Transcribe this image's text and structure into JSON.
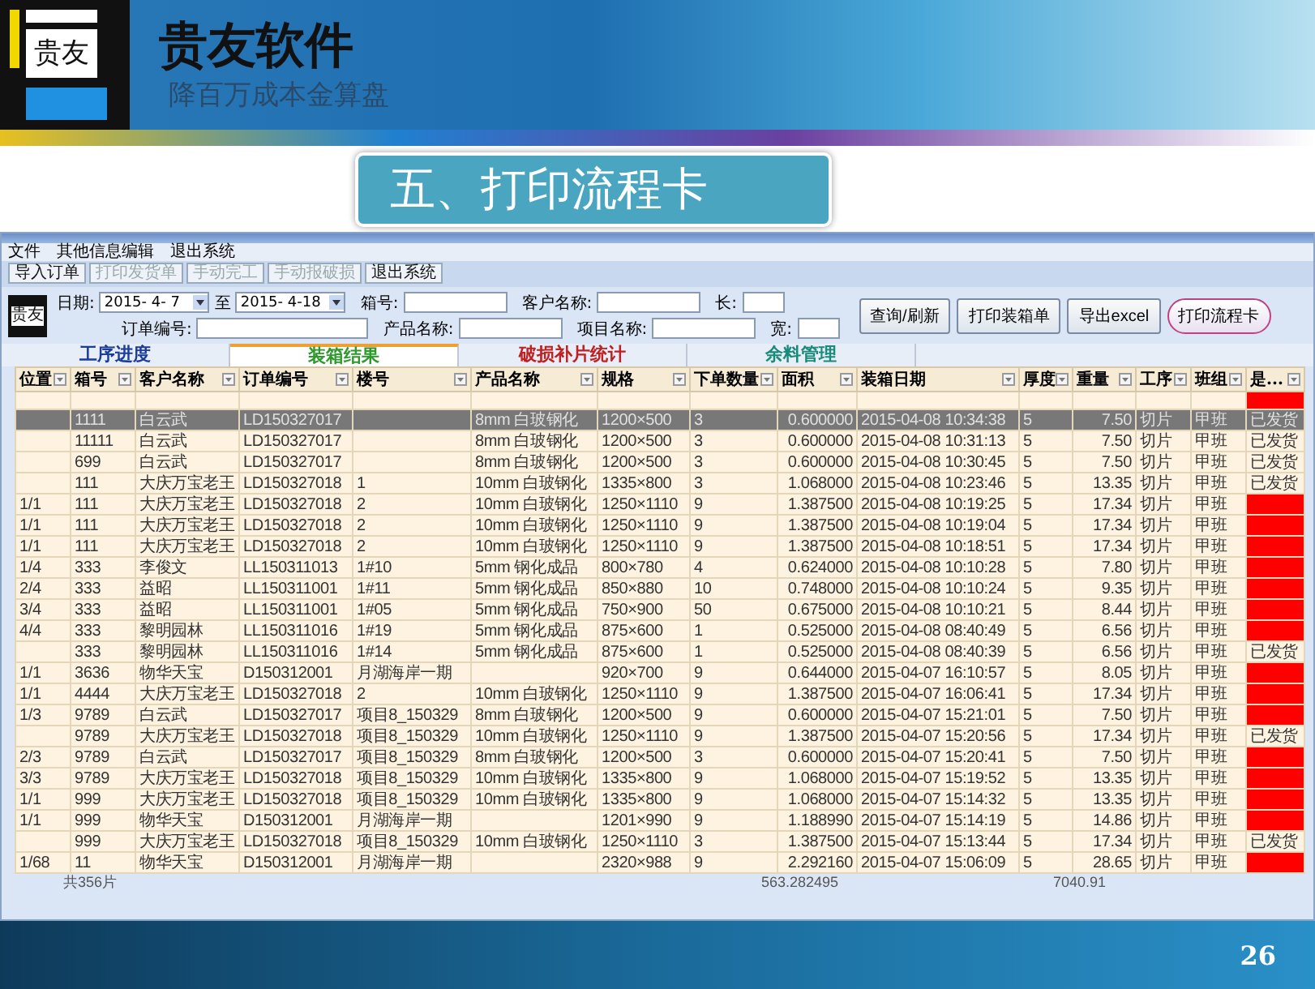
{
  "slide": {
    "logo_text": "贵友",
    "title": "贵友软件",
    "subtitle": "降百万成本金算盘",
    "section_title": "五、打印流程卡",
    "page_number": "26"
  },
  "app": {
    "menu": [
      "文件",
      "其他信息编辑",
      "退出系统"
    ],
    "toolbar": [
      {
        "label": "导入订单",
        "disabled": false
      },
      {
        "label": "打印发货单",
        "disabled": true
      },
      {
        "label": "手动完工",
        "disabled": true
      },
      {
        "label": "手动报破损",
        "disabled": true
      },
      {
        "label": "退出系统",
        "disabled": false
      }
    ],
    "filter": {
      "logo_text": "贵友",
      "date_label": "日期:",
      "date_from": "2015- 4- 7",
      "to_label": "至",
      "date_to": "2015- 4-18",
      "fields": [
        {
          "label": "箱号:"
        },
        {
          "label": "客户名称:"
        },
        {
          "label": "长:"
        },
        {
          "label": "订单编号:"
        },
        {
          "label": "产品名称:"
        },
        {
          "label": "项目名称:"
        },
        {
          "label": "宽:"
        }
      ]
    },
    "buttons": [
      {
        "label": "查询/刷新",
        "highlighted": false
      },
      {
        "label": "打印装箱单",
        "highlighted": false
      },
      {
        "label": "导出excel",
        "highlighted": false
      },
      {
        "label": "打印流程卡",
        "highlighted": true
      }
    ],
    "tabs": [
      {
        "label": "工序进度",
        "selected": false,
        "color": "#1a3c9a"
      },
      {
        "label": "装箱结果",
        "selected": true,
        "color": "#2e9a2e"
      },
      {
        "label": "破损补片统计",
        "selected": false,
        "color": "#c02020"
      },
      {
        "label": "余料管理",
        "selected": false,
        "color": "#1a8a7a"
      }
    ],
    "table": {
      "columns": [
        "位置",
        "箱号",
        "客户名称",
        "订单编号",
        "楼号",
        "产品名称",
        "规格",
        "下单数量",
        "面积",
        "装箱日期",
        "厚度",
        "重量",
        "工序",
        "班组",
        "是..."
      ],
      "filter_row": {
        "flagged": true
      },
      "rows": [
        {
          "cells": [
            "",
            "1111",
            "白云武",
            "LD150327017",
            "",
            "8mm 白玻钢化",
            "1200×500",
            "3",
            "0.600000",
            "2015-04-08 10:34:38",
            "5",
            "7.50",
            "切片",
            "甲班"
          ],
          "selected": true,
          "flagged": false,
          "status": "已发货"
        },
        {
          "cells": [
            "",
            "11111",
            "白云武",
            "LD150327017",
            "",
            "8mm 白玻钢化",
            "1200×500",
            "3",
            "0.600000",
            "2015-04-08 10:31:13",
            "5",
            "7.50",
            "切片",
            "甲班"
          ],
          "selected": false,
          "flagged": false,
          "status": "已发货"
        },
        {
          "cells": [
            "",
            "699",
            "白云武",
            "LD150327017",
            "",
            "8mm 白玻钢化",
            "1200×500",
            "3",
            "0.600000",
            "2015-04-08 10:30:45",
            "5",
            "7.50",
            "切片",
            "甲班"
          ],
          "selected": false,
          "flagged": false,
          "status": "已发货"
        },
        {
          "cells": [
            "",
            "111",
            "大庆万宝老王",
            "LD150327018",
            "1",
            "10mm 白玻钢化",
            "1335×800",
            "3",
            "1.068000",
            "2015-04-08 10:23:46",
            "5",
            "13.35",
            "切片",
            "甲班"
          ],
          "selected": false,
          "flagged": false,
          "status": "已发货"
        },
        {
          "cells": [
            "1/1",
            "111",
            "大庆万宝老王",
            "LD150327018",
            "2",
            "10mm 白玻钢化",
            "1250×1110",
            "9",
            "1.387500",
            "2015-04-08 10:19:25",
            "5",
            "17.34",
            "切片",
            "甲班"
          ],
          "selected": false,
          "flagged": true
        },
        {
          "cells": [
            "1/1",
            "111",
            "大庆万宝老王",
            "LD150327018",
            "2",
            "10mm 白玻钢化",
            "1250×1110",
            "9",
            "1.387500",
            "2015-04-08 10:19:04",
            "5",
            "17.34",
            "切片",
            "甲班"
          ],
          "selected": false,
          "flagged": true
        },
        {
          "cells": [
            "1/1",
            "111",
            "大庆万宝老王",
            "LD150327018",
            "2",
            "10mm 白玻钢化",
            "1250×1110",
            "9",
            "1.387500",
            "2015-04-08 10:18:51",
            "5",
            "17.34",
            "切片",
            "甲班"
          ],
          "selected": false,
          "flagged": true
        },
        {
          "cells": [
            "1/4",
            "333",
            "李俊文",
            "LL150311013",
            "1#10",
            "5mm 钢化成品",
            "800×780",
            "4",
            "0.624000",
            "2015-04-08 10:10:28",
            "5",
            "7.80",
            "切片",
            "甲班"
          ],
          "selected": false,
          "flagged": true
        },
        {
          "cells": [
            "2/4",
            "333",
            "益昭",
            "LL150311001",
            "1#11",
            "5mm 钢化成品",
            "850×880",
            "10",
            "0.748000",
            "2015-04-08 10:10:24",
            "5",
            "9.35",
            "切片",
            "甲班"
          ],
          "selected": false,
          "flagged": true
        },
        {
          "cells": [
            "3/4",
            "333",
            "益昭",
            "LL150311001",
            "1#05",
            "5mm 钢化成品",
            "750×900",
            "50",
            "0.675000",
            "2015-04-08 10:10:21",
            "5",
            "8.44",
            "切片",
            "甲班"
          ],
          "selected": false,
          "flagged": true
        },
        {
          "cells": [
            "4/4",
            "333",
            "黎明园林",
            "LL150311016",
            "1#19",
            "5mm 钢化成品",
            "875×600",
            "1",
            "0.525000",
            "2015-04-08 08:40:49",
            "5",
            "6.56",
            "切片",
            "甲班"
          ],
          "selected": false,
          "flagged": true
        },
        {
          "cells": [
            "",
            "333",
            "黎明园林",
            "LL150311016",
            "1#14",
            "5mm 钢化成品",
            "875×600",
            "1",
            "0.525000",
            "2015-04-08 08:40:39",
            "5",
            "6.56",
            "切片",
            "甲班"
          ],
          "selected": false,
          "flagged": false,
          "status": "已发货"
        },
        {
          "cells": [
            "1/1",
            "3636",
            "物华天宝",
            "D150312001",
            "月湖海岸一期",
            "",
            "920×700",
            "9",
            "0.644000",
            "2015-04-07 16:10:57",
            "5",
            "8.05",
            "切片",
            "甲班"
          ],
          "selected": false,
          "flagged": true
        },
        {
          "cells": [
            "1/1",
            "4444",
            "大庆万宝老王",
            "LD150327018",
            "2",
            "10mm 白玻钢化",
            "1250×1110",
            "9",
            "1.387500",
            "2015-04-07 16:06:41",
            "5",
            "17.34",
            "切片",
            "甲班"
          ],
          "selected": false,
          "flagged": true
        },
        {
          "cells": [
            "1/3",
            "9789",
            "白云武",
            "LD150327017",
            "项目8_150329",
            "8mm 白玻钢化",
            "1200×500",
            "9",
            "0.600000",
            "2015-04-07 15:21:01",
            "5",
            "7.50",
            "切片",
            "甲班"
          ],
          "selected": false,
          "flagged": true
        },
        {
          "cells": [
            "",
            "9789",
            "大庆万宝老王",
            "LD150327018",
            "项目8_150329",
            "10mm 白玻钢化",
            "1250×1110",
            "9",
            "1.387500",
            "2015-04-07 15:20:56",
            "5",
            "17.34",
            "切片",
            "甲班"
          ],
          "selected": false,
          "flagged": false,
          "status": "已发货"
        },
        {
          "cells": [
            "2/3",
            "9789",
            "白云武",
            "LD150327017",
            "项目8_150329",
            "8mm 白玻钢化",
            "1200×500",
            "3",
            "0.600000",
            "2015-04-07 15:20:41",
            "5",
            "7.50",
            "切片",
            "甲班"
          ],
          "selected": false,
          "flagged": true
        },
        {
          "cells": [
            "3/3",
            "9789",
            "大庆万宝老王",
            "LD150327018",
            "项目8_150329",
            "10mm 白玻钢化",
            "1335×800",
            "9",
            "1.068000",
            "2015-04-07 15:19:52",
            "5",
            "13.35",
            "切片",
            "甲班"
          ],
          "selected": false,
          "flagged": true
        },
        {
          "cells": [
            "1/1",
            "999",
            "大庆万宝老王",
            "LD150327018",
            "项目8_150329",
            "10mm 白玻钢化",
            "1335×800",
            "9",
            "1.068000",
            "2015-04-07 15:14:32",
            "5",
            "13.35",
            "切片",
            "甲班"
          ],
          "selected": false,
          "flagged": true
        },
        {
          "cells": [
            "1/1",
            "999",
            "物华天宝",
            "D150312001",
            "月湖海岸一期",
            "",
            "1201×990",
            "9",
            "1.188990",
            "2015-04-07 15:14:19",
            "5",
            "14.86",
            "切片",
            "甲班"
          ],
          "selected": false,
          "flagged": true
        },
        {
          "cells": [
            "",
            "999",
            "大庆万宝老王",
            "LD150327018",
            "项目8_150329",
            "10mm 白玻钢化",
            "1250×1110",
            "3",
            "1.387500",
            "2015-04-07 15:13:44",
            "5",
            "17.34",
            "切片",
            "甲班"
          ],
          "selected": false,
          "flagged": false,
          "status": "已发货"
        },
        {
          "cells": [
            "1/68",
            "11",
            "物华天宝",
            "D150312001",
            "月湖海岸一期",
            "",
            "2320×988",
            "9",
            "2.292160",
            "2015-04-07 15:06:09",
            "5",
            "28.65",
            "切片",
            "甲班"
          ],
          "selected": false,
          "flagged": true
        }
      ],
      "footer": {
        "count": "共356片",
        "area_total": "563.282495",
        "weight_total": "7040.91"
      }
    }
  }
}
